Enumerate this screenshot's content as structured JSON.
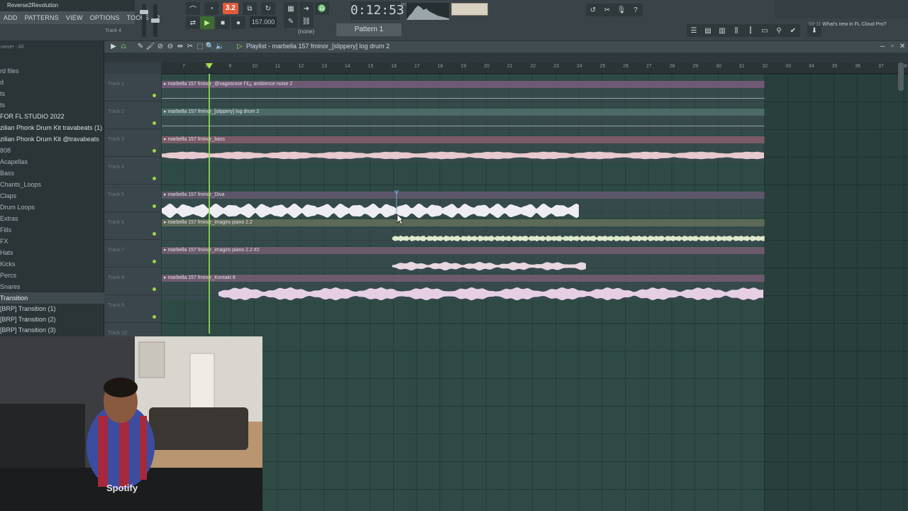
{
  "app": {
    "title": "Reverse2Revolution",
    "menu": [
      "ADD",
      "PATTERNS",
      "VIEW",
      "OPTIONS",
      "TOOLS",
      "?"
    ],
    "hint": "Track 4"
  },
  "transport": {
    "pattern_mode": "3.2",
    "tempo": "157.000",
    "time": "0:12:53",
    "time_sub": "M:S:CS",
    "pattern": "Pattern 1",
    "channel": "(none)"
  },
  "whats_new": {
    "date": "03-11",
    "text": "What's new in FL Cloud Pro?"
  },
  "browser": {
    "header": "owser - All",
    "items": [
      {
        "label": "rd files",
        "style": "normal"
      },
      {
        "label": "d",
        "style": "normal"
      },
      {
        "label": "ts",
        "style": "normal"
      },
      {
        "label": "ts",
        "style": "normal"
      },
      {
        "label": "FOR FL STUDIO 2022",
        "style": "bright"
      },
      {
        "label": "zilian Phonk Drum Kit travabeats (1)",
        "style": "bright"
      },
      {
        "label": "zilian Phonk Drum Kit @travabeats",
        "style": "bright"
      },
      {
        "label": "808",
        "style": "normal"
      },
      {
        "label": "Acapellas",
        "style": "normal"
      },
      {
        "label": "Bass",
        "style": "normal"
      },
      {
        "label": "Chants_Loops",
        "style": "normal"
      },
      {
        "label": "Claps",
        "style": "normal"
      },
      {
        "label": "Drum Loops",
        "style": "normal"
      },
      {
        "label": "Extras",
        "style": "normal"
      },
      {
        "label": "Fills",
        "style": "normal"
      },
      {
        "label": "FX",
        "style": "normal"
      },
      {
        "label": "Hats",
        "style": "normal"
      },
      {
        "label": "Kicks",
        "style": "normal"
      },
      {
        "label": "Percs",
        "style": "normal"
      },
      {
        "label": "Snares",
        "style": "normal"
      },
      {
        "label": "Transition",
        "style": "sel"
      },
      {
        "label": "[BRP] Transition (1)",
        "style": "sub"
      },
      {
        "label": "[BRP] Transition (2)",
        "style": "sub"
      },
      {
        "label": "[BRP] Transition (3)",
        "style": "sub"
      }
    ]
  },
  "playlist": {
    "title": "Playlist - marbella 157 fminor_[slippery] log drum 2",
    "ruler": [
      "7",
      "8",
      "9",
      "10",
      "11",
      "12",
      "13",
      "14",
      "15",
      "16",
      "17",
      "18",
      "19",
      "20",
      "21",
      "22",
      "23",
      "24",
      "25",
      "26",
      "27",
      "28",
      "29",
      "30",
      "31",
      "32",
      "33",
      "34",
      "35",
      "36",
      "37",
      "38"
    ],
    "tracks": [
      "Track 1",
      "Track 2",
      "Track 3",
      "Track 4",
      "Track 5",
      "Track 6",
      "Track 7",
      "Track 8",
      "Track 9",
      "Track 10"
    ],
    "clips": [
      {
        "track": 0,
        "label": "marbella 157 fminor_@vagosrose Γ£¿ ambience noise 2",
        "color": "#6e5a72",
        "wave": "none"
      },
      {
        "track": 1,
        "label": "marbella 157 fminor_[slippery] log drum 2",
        "color": "#4e6a66",
        "wave": "none"
      },
      {
        "track": 2,
        "label": "marbella 157 fminor_bass",
        "color": "#7a5a66",
        "wave": "bass"
      },
      {
        "track": 4,
        "label": "marbella 157 fminor_Diva",
        "color": "#5c5768",
        "wave": "diva"
      },
      {
        "track": 5,
        "label": "marbella 157 fminor_imagiro piano 2.2",
        "color": "#5d6a58",
        "wave": "piano"
      },
      {
        "track": 6,
        "label": "marbella 157 fminor_imagiro piano 2.2 #2",
        "color": "#6b5a6c",
        "wave": "piano2"
      },
      {
        "track": 7,
        "label": "marbella 157 fminor_Kontakt 8",
        "color": "#6d5a6e",
        "wave": "kontakt"
      }
    ]
  },
  "colors": {
    "accent_green": "#8fe05b",
    "pattern_orange": "#e05b3d"
  }
}
